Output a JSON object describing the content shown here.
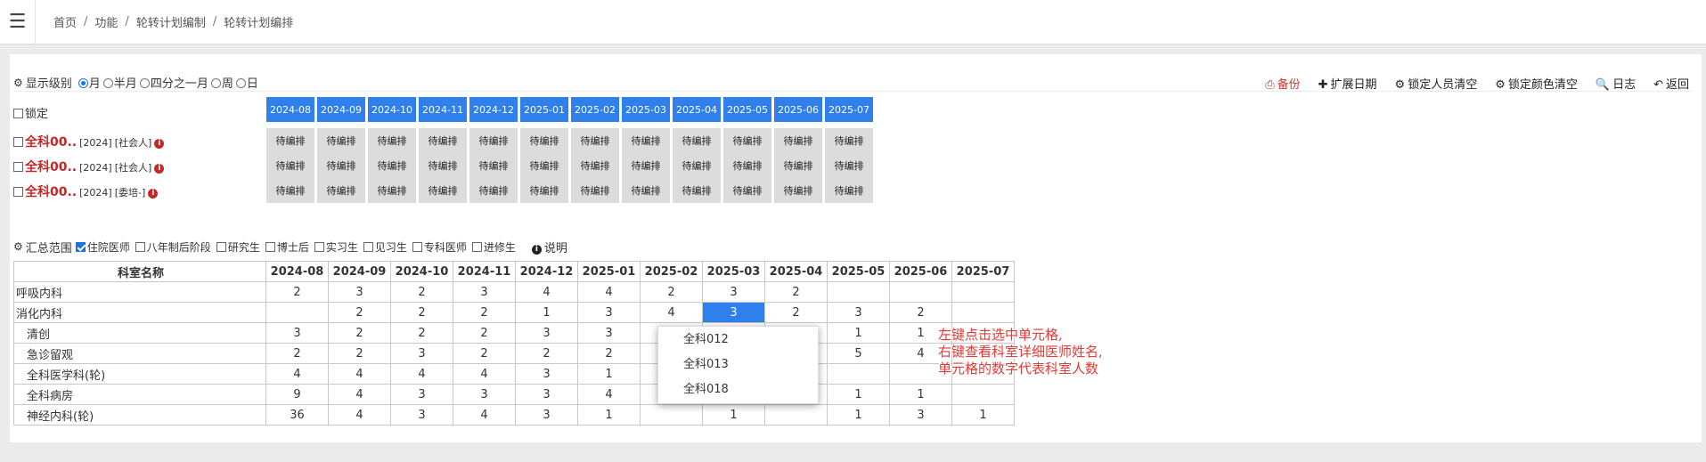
{
  "breadcrumb": [
    "首页",
    "功能",
    "轮转计划编制",
    "轮转计划编排"
  ],
  "display": {
    "label": "显示级别",
    "options": [
      "月",
      "半月",
      "四分之一月",
      "周",
      "日"
    ],
    "selected": 0
  },
  "actions": [
    {
      "label": "备份",
      "icon": "save-icon",
      "color": "#c0392b"
    },
    {
      "label": "扩展日期",
      "icon": "plus-icon"
    },
    {
      "label": "锁定人员清空",
      "icon": "gear-icon"
    },
    {
      "label": "锁定颜色清空",
      "icon": "gear-icon"
    },
    {
      "label": "日志",
      "icon": "search-icon"
    },
    {
      "label": "返回",
      "icon": "back-arrow-icon"
    }
  ],
  "lock_label": "锁定",
  "months": [
    "2024-08",
    "2024-09",
    "2024-10",
    "2024-11",
    "2024-12",
    "2025-01",
    "2025-02",
    "2025-03",
    "2025-04",
    "2025-05",
    "2025-06",
    "2025-07"
  ],
  "people": [
    {
      "name": "全科00..",
      "year": "[2024]",
      "type": "[社会人]"
    },
    {
      "name": "全科00..",
      "year": "[2024]",
      "type": "[社会人]"
    },
    {
      "name": "全科00..",
      "year": "[2024]",
      "type": "[委培-]"
    }
  ],
  "pending_label": "待编排",
  "summary": {
    "label": "汇总范围",
    "options": [
      {
        "label": "住院医师",
        "checked": true
      },
      {
        "label": "八年制后阶段",
        "checked": false
      },
      {
        "label": "研究生",
        "checked": false
      },
      {
        "label": "博士后",
        "checked": false
      },
      {
        "label": "实习生",
        "checked": false
      },
      {
        "label": "见习生",
        "checked": false
      },
      {
        "label": "专科医师",
        "checked": false
      },
      {
        "label": "进修生",
        "checked": false
      }
    ],
    "explain": "说明"
  },
  "table": {
    "header": "科室名称",
    "rows": [
      {
        "name": "呼吸内科",
        "sub": false,
        "values": [
          "2",
          "3",
          "2",
          "3",
          "4",
          "4",
          "2",
          "3",
          "2",
          "",
          "",
          ""
        ]
      },
      {
        "name": "消化内科",
        "sub": false,
        "values": [
          "",
          "2",
          "2",
          "2",
          "1",
          "3",
          "4",
          "3",
          "2",
          "3",
          "2",
          ""
        ]
      },
      {
        "name": "清创",
        "sub": true,
        "values": [
          "3",
          "2",
          "2",
          "2",
          "3",
          "3",
          "",
          "",
          "",
          "1",
          "1",
          ""
        ]
      },
      {
        "name": "急诊留观",
        "sub": true,
        "values": [
          "2",
          "2",
          "3",
          "2",
          "2",
          "2",
          "",
          "",
          "",
          "5",
          "4",
          ""
        ]
      },
      {
        "name": "全科医学科(轮)",
        "sub": true,
        "values": [
          "4",
          "4",
          "4",
          "4",
          "3",
          "1",
          "",
          "",
          "",
          "",
          "",
          ""
        ]
      },
      {
        "name": "全科病房",
        "sub": true,
        "values": [
          "9",
          "4",
          "3",
          "3",
          "3",
          "4",
          "",
          "",
          "",
          "1",
          "1",
          ""
        ]
      },
      {
        "name": "神经内科(轮)",
        "sub": true,
        "values": [
          "36",
          "4",
          "3",
          "4",
          "3",
          "1",
          "",
          "1",
          "",
          "1",
          "3",
          "1"
        ]
      }
    ],
    "selected": {
      "row": 1,
      "col": 7
    }
  },
  "context_menu": [
    "全科012",
    "全科013",
    "全科018"
  ],
  "note": [
    "左键点击选中单元格,",
    "右键查看科室详细医师姓名,",
    "单元格的数字代表科室人数"
  ]
}
